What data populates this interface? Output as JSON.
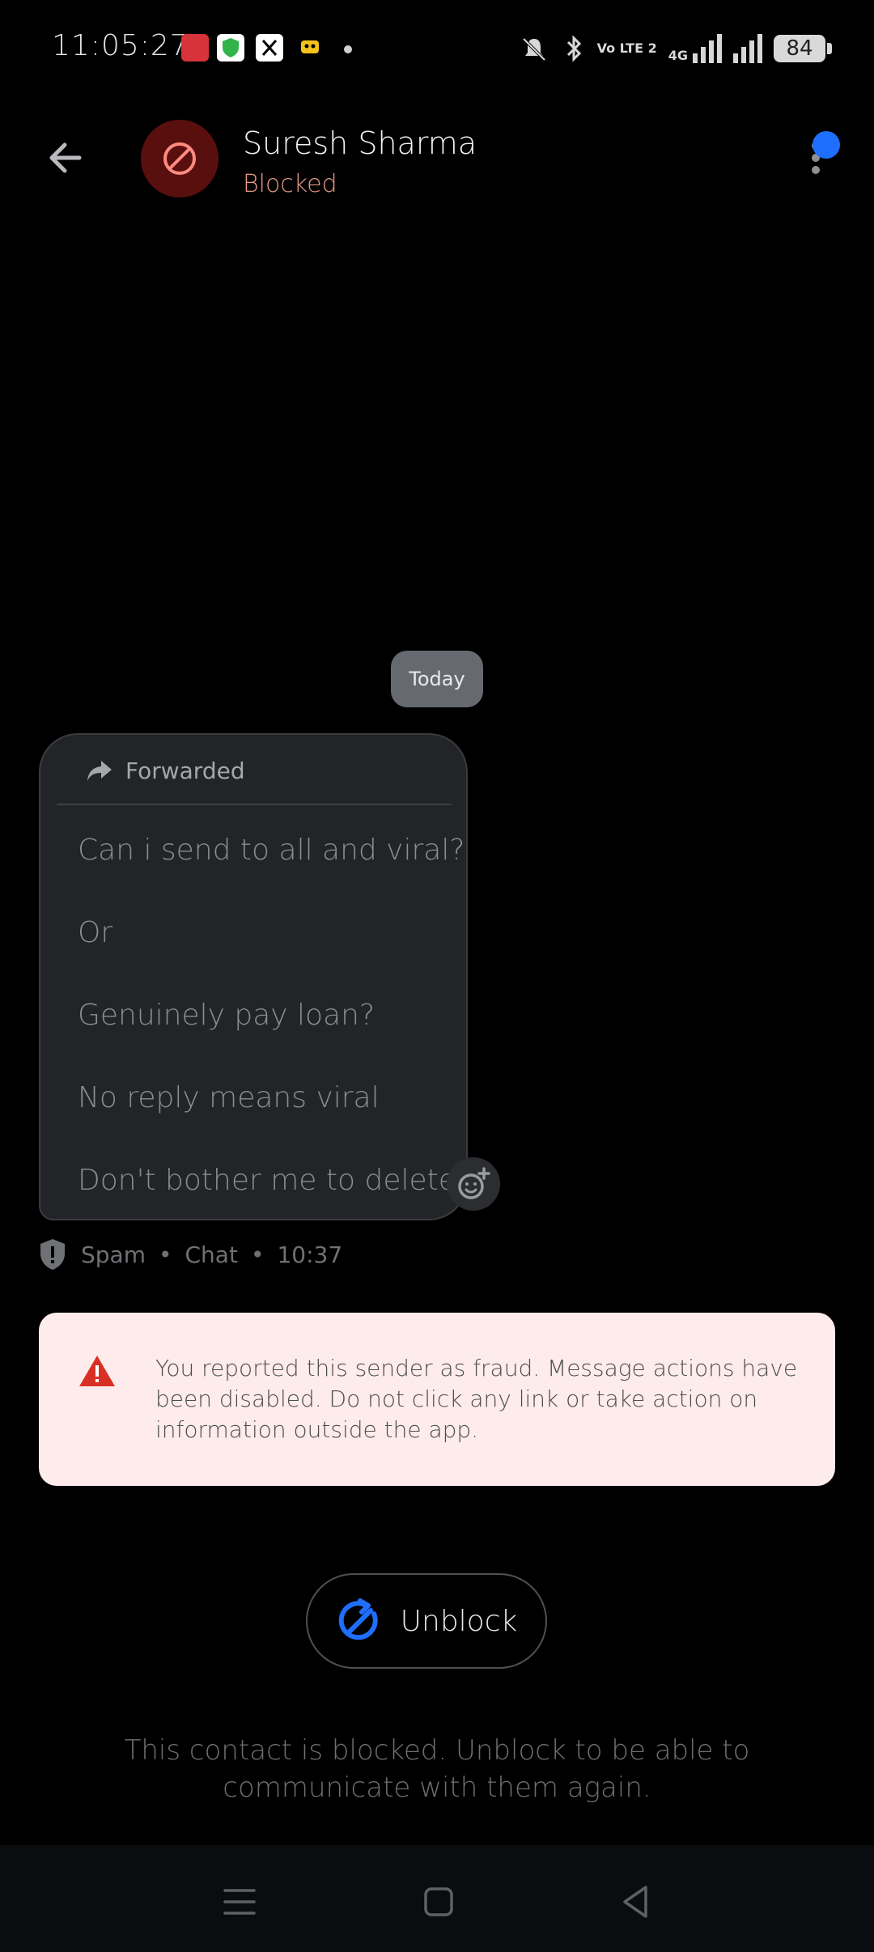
{
  "status_bar": {
    "time": "11:05:27",
    "battery": "84",
    "network_label": "4G",
    "volte_label": "Vo LTE 2"
  },
  "header": {
    "contact_name": "Suresh Sharma",
    "contact_status": "Blocked",
    "status_color": "#e79b86",
    "avatar_color": "#5a0f0f"
  },
  "conversation": {
    "date_chip": "Today",
    "message": {
      "forwarded_label": "Forwarded",
      "lines": [
        "Can i send to all and viral?",
        "Or",
        "Genuinely pay loan?",
        "No reply means viral",
        "Don't bother me to delete"
      ],
      "meta": {
        "category": "Spam",
        "type": "Chat",
        "time": "10:37"
      }
    }
  },
  "warning": {
    "text": "You reported this sender as fraud. Message actions have been disabled. Do not click any link or take action on information outside the app.",
    "background": "#fdeceb",
    "icon_color": "#d93025"
  },
  "unblock": {
    "label": "Unblock",
    "icon_color": "#1f6fff"
  },
  "blocked_note": "This contact is blocked. Unblock to be able to communicate with them again.",
  "icons": {
    "back": "arrow-left-icon",
    "menu": "more-vert-icon",
    "forward": "forward-arrow-icon",
    "spam": "shield-icon",
    "warning": "warning-triangle-icon",
    "unblock": "unblock-icon",
    "react": "add-reaction-icon"
  }
}
